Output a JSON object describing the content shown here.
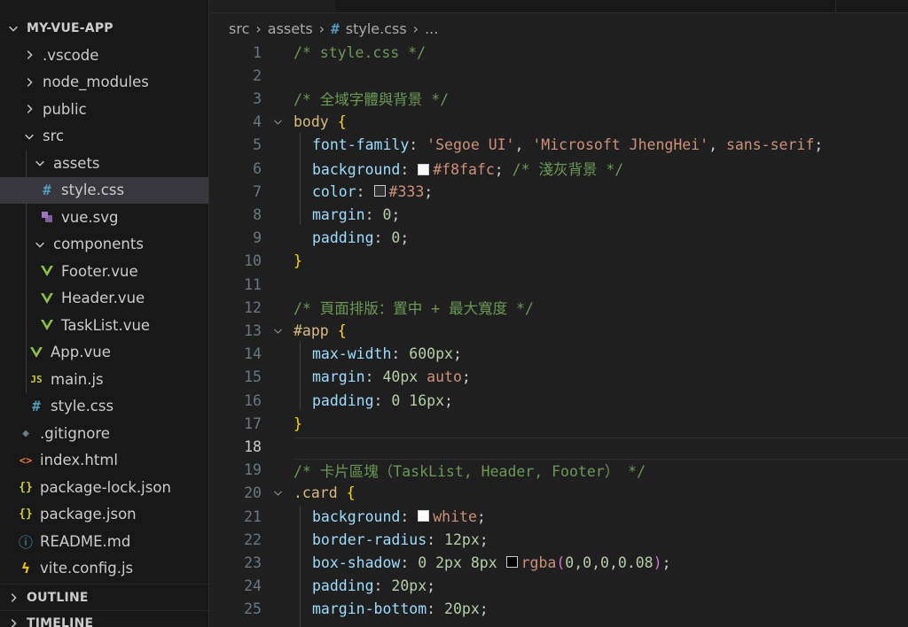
{
  "explorer": {
    "project": "MY-VUE-APP",
    "items": [
      {
        "label": ".vscode",
        "kind": "folder",
        "icon": "chevron-right-icon"
      },
      {
        "label": "node_modules",
        "kind": "folder",
        "icon": "chevron-right-icon"
      },
      {
        "label": "public",
        "kind": "folder",
        "icon": "chevron-right-icon"
      },
      {
        "label": "src",
        "kind": "folder-open",
        "icon": "chevron-down-icon"
      },
      {
        "label": "assets",
        "kind": "folder-open",
        "icon": "chevron-down-icon"
      },
      {
        "label": "style.css",
        "kind": "file",
        "icon": "css-file-icon",
        "glyph": "#",
        "selected": true
      },
      {
        "label": "vue.svg",
        "kind": "file",
        "icon": "svg-file-icon"
      },
      {
        "label": "components",
        "kind": "folder-open",
        "icon": "chevron-down-icon"
      },
      {
        "label": "Footer.vue",
        "kind": "file",
        "icon": "vue-file-icon",
        "glyph": "V"
      },
      {
        "label": "Header.vue",
        "kind": "file",
        "icon": "vue-file-icon",
        "glyph": "V"
      },
      {
        "label": "TaskList.vue",
        "kind": "file",
        "icon": "vue-file-icon",
        "glyph": "V"
      },
      {
        "label": "App.vue",
        "kind": "file",
        "icon": "vue-file-icon",
        "glyph": "V"
      },
      {
        "label": "main.js",
        "kind": "file",
        "icon": "js-file-icon",
        "glyph": "JS"
      },
      {
        "label": "style.css",
        "kind": "file",
        "icon": "css-file-icon",
        "glyph": "#"
      },
      {
        "label": ".gitignore",
        "kind": "file",
        "icon": "git-file-icon",
        "glyph": "◆"
      },
      {
        "label": "index.html",
        "kind": "file",
        "icon": "html-file-icon",
        "glyph": "<>"
      },
      {
        "label": "package-lock.json",
        "kind": "file",
        "icon": "json-file-icon",
        "glyph": "{}"
      },
      {
        "label": "package.json",
        "kind": "file",
        "icon": "json-file-icon",
        "glyph": "{}"
      },
      {
        "label": "README.md",
        "kind": "file",
        "icon": "info-file-icon",
        "glyph": "ⓘ"
      },
      {
        "label": "vite.config.js",
        "kind": "file",
        "icon": "vite-file-icon",
        "glyph": "ϟ"
      }
    ],
    "outline_label": "OUTLINE",
    "timeline_label": "TIMELINE"
  },
  "breadcrumb": {
    "segments": [
      "src",
      "assets",
      "style.css",
      "..."
    ],
    "file_glyph": "#"
  },
  "colors": {
    "comment": "#6a9955",
    "selector": "#d7ba7d",
    "brace": "#ffd700",
    "property": "#9cdcfe",
    "string": "#ce9178",
    "number": "#b5cea8",
    "vue": "#8dc149",
    "css": "#519aba",
    "js": "#cbcb41",
    "git": "#41535b",
    "html": "#e37933",
    "json": "#cbcb41",
    "selected_row": "#37373d"
  },
  "editor": {
    "current_line": 18,
    "lines": [
      {
        "n": "1",
        "indent": 0,
        "tokens": [
          [
            "c-com",
            "/* style.css */"
          ]
        ]
      },
      {
        "n": "2",
        "indent": 0,
        "tokens": []
      },
      {
        "n": "3",
        "indent": 0,
        "tokens": [
          [
            "c-com",
            "/* 全域字體與背景 */"
          ]
        ]
      },
      {
        "n": "4",
        "indent": 0,
        "fold": true,
        "tokens": [
          [
            "c-sel",
            "body"
          ],
          [
            "c-plain",
            " "
          ],
          [
            "c-brace",
            "{"
          ]
        ]
      },
      {
        "n": "5",
        "indent": 1,
        "tokens": [
          [
            "c-prop",
            "font-family"
          ],
          [
            "c-plain",
            ": "
          ],
          [
            "c-str",
            "'Segoe UI'"
          ],
          [
            "c-plain",
            ", "
          ],
          [
            "c-str",
            "'Microsoft JhengHei'"
          ],
          [
            "c-plain",
            ", "
          ],
          [
            "c-val",
            "sans-serif"
          ],
          [
            "c-plain",
            ";"
          ]
        ]
      },
      {
        "n": "6",
        "indent": 1,
        "tokens": [
          [
            "c-prop",
            "background"
          ],
          [
            "c-plain",
            ": "
          ],
          [
            "swatch",
            "#f8fafc"
          ],
          [
            "c-val",
            "#f8fafc"
          ],
          [
            "c-plain",
            "; "
          ],
          [
            "c-com",
            "/* 淺灰背景 */"
          ]
        ]
      },
      {
        "n": "7",
        "indent": 1,
        "tokens": [
          [
            "c-prop",
            "color"
          ],
          [
            "c-plain",
            ": "
          ],
          [
            "swatch",
            "#333333"
          ],
          [
            "c-val",
            "#333"
          ],
          [
            "c-plain",
            ";"
          ]
        ]
      },
      {
        "n": "8",
        "indent": 1,
        "tokens": [
          [
            "c-prop",
            "margin"
          ],
          [
            "c-plain",
            ": "
          ],
          [
            "c-num",
            "0"
          ],
          [
            "c-plain",
            ";"
          ]
        ]
      },
      {
        "n": "9",
        "indent": 1,
        "tokens": [
          [
            "c-prop",
            "padding"
          ],
          [
            "c-plain",
            ": "
          ],
          [
            "c-num",
            "0"
          ],
          [
            "c-plain",
            ";"
          ]
        ]
      },
      {
        "n": "10",
        "indent": 0,
        "tokens": [
          [
            "c-brace",
            "}"
          ]
        ]
      },
      {
        "n": "11",
        "indent": 0,
        "tokens": []
      },
      {
        "n": "12",
        "indent": 0,
        "tokens": [
          [
            "c-com",
            "/* 頁面排版：置中 + 最大寬度 */"
          ]
        ]
      },
      {
        "n": "13",
        "indent": 0,
        "fold": true,
        "tokens": [
          [
            "c-sel",
            "#app"
          ],
          [
            "c-plain",
            " "
          ],
          [
            "c-brace",
            "{"
          ]
        ]
      },
      {
        "n": "14",
        "indent": 1,
        "tokens": [
          [
            "c-prop",
            "max-width"
          ],
          [
            "c-plain",
            ": "
          ],
          [
            "c-num",
            "600px"
          ],
          [
            "c-plain",
            ";"
          ]
        ]
      },
      {
        "n": "15",
        "indent": 1,
        "tokens": [
          [
            "c-prop",
            "margin"
          ],
          [
            "c-plain",
            ": "
          ],
          [
            "c-num",
            "40px"
          ],
          [
            "c-plain",
            " "
          ],
          [
            "c-val",
            "auto"
          ],
          [
            "c-plain",
            ";"
          ]
        ]
      },
      {
        "n": "16",
        "indent": 1,
        "tokens": [
          [
            "c-prop",
            "padding"
          ],
          [
            "c-plain",
            ": "
          ],
          [
            "c-num",
            "0"
          ],
          [
            "c-plain",
            " "
          ],
          [
            "c-num",
            "16px"
          ],
          [
            "c-plain",
            ";"
          ]
        ]
      },
      {
        "n": "17",
        "indent": 0,
        "tokens": [
          [
            "c-brace",
            "}"
          ]
        ]
      },
      {
        "n": "18",
        "indent": 0,
        "tokens": []
      },
      {
        "n": "19",
        "indent": 0,
        "tokens": [
          [
            "c-com",
            "/* 卡片區塊（TaskList, Header, Footer） */"
          ]
        ]
      },
      {
        "n": "20",
        "indent": 0,
        "fold": true,
        "tokens": [
          [
            "c-sel",
            ".card"
          ],
          [
            "c-plain",
            " "
          ],
          [
            "c-brace",
            "{"
          ]
        ]
      },
      {
        "n": "21",
        "indent": 1,
        "tokens": [
          [
            "c-prop",
            "background"
          ],
          [
            "c-plain",
            ": "
          ],
          [
            "swatch",
            "#ffffff"
          ],
          [
            "c-val",
            "white"
          ],
          [
            "c-plain",
            ";"
          ]
        ]
      },
      {
        "n": "22",
        "indent": 1,
        "tokens": [
          [
            "c-prop",
            "border-radius"
          ],
          [
            "c-plain",
            ": "
          ],
          [
            "c-num",
            "12px"
          ],
          [
            "c-plain",
            ";"
          ]
        ]
      },
      {
        "n": "23",
        "indent": 1,
        "tokens": [
          [
            "c-prop",
            "box-shadow"
          ],
          [
            "c-plain",
            ": "
          ],
          [
            "c-num",
            "0"
          ],
          [
            "c-plain",
            " "
          ],
          [
            "c-num",
            "2px"
          ],
          [
            "c-plain",
            " "
          ],
          [
            "c-num",
            "8px"
          ],
          [
            "c-plain",
            " "
          ],
          [
            "swatch",
            "#000000"
          ],
          [
            "c-val",
            "rgba"
          ],
          [
            "c-paren",
            "("
          ],
          [
            "c-num",
            "0,0,0,0.08"
          ],
          [
            "c-paren",
            ")"
          ],
          [
            "c-plain",
            ";"
          ]
        ]
      },
      {
        "n": "24",
        "indent": 1,
        "tokens": [
          [
            "c-prop",
            "padding"
          ],
          [
            "c-plain",
            ": "
          ],
          [
            "c-num",
            "20px"
          ],
          [
            "c-plain",
            ";"
          ]
        ]
      },
      {
        "n": "25",
        "indent": 1,
        "tokens": [
          [
            "c-prop",
            "margin-bottom"
          ],
          [
            "c-plain",
            ": "
          ],
          [
            "c-num",
            "20px"
          ],
          [
            "c-plain",
            ";"
          ]
        ]
      }
    ]
  }
}
